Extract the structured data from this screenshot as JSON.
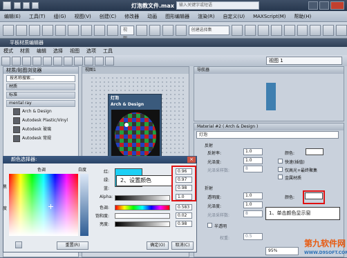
{
  "app": {
    "title": "灯泡教文件.max",
    "search_placeholder": "输入关键字或短语"
  },
  "menubar": [
    "编辑(E)",
    "工具(T)",
    "组(G)",
    "视图(V)",
    "创建(C)",
    "修改器",
    "动画",
    "图形编辑器",
    "渲染(R)",
    "自定义(U)",
    "MAXScript(M)",
    "帮助(H)"
  ],
  "toolbar": {
    "selection_set_placeholder": "创建选择集",
    "view_label": "视图"
  },
  "sme": {
    "title": "平板材质编辑器",
    "menu": [
      "模式",
      "材质",
      "编辑",
      "选择",
      "视图",
      "选项",
      "工具"
    ],
    "view_select": "视图 1"
  },
  "browser": {
    "header": "材质/贴图浏览器",
    "search_placeholder": "按名称搜索...",
    "categories": [
      "材质",
      "标准",
      "mental ray"
    ],
    "materials": [
      "Arch & Design",
      "Autodesk Plastic/Vinyl",
      "Autodesk 玻璃",
      "Autodesk 常规"
    ]
  },
  "view1": {
    "tab": "视图1",
    "node_title": "灯泡",
    "node_subtitle": "Arch & Design"
  },
  "navigator": {
    "header": "导航器"
  },
  "params": {
    "header": "Material #2 ( Arch & Design )",
    "material_name": "灯泡",
    "reflection": {
      "group": "反射",
      "reflectivity_label": "反射率:",
      "reflectivity": "1.0",
      "color_label": "颜色:",
      "gloss_label": "光泽度:",
      "gloss": "1.0",
      "gloss_samples_label": "光泽采样数:",
      "gloss_samples": "8",
      "fast_label": "快速(插值)",
      "highlights_label": "仅高光+最终聚集",
      "metal_label": "金属材质"
    },
    "refraction": {
      "group": "折射",
      "transparency_label": "透明度:",
      "transparency": "1.0",
      "color_label": "颜色:",
      "gloss_label": "光泽度:",
      "gloss": "1.0",
      "gloss_samples_label": "光泽采样数:",
      "gloss_samples": "8"
    },
    "translucency_label": "半透明",
    "weight_label": "权重:",
    "weight": "0.5",
    "zoom": "95%"
  },
  "color_dialog": {
    "title": "颜色选择器:",
    "hue_label": "色调",
    "whiteness_label": "白度",
    "black_label": "黑",
    "degree_label": "度",
    "channels": [
      {
        "label": "红:",
        "value": "0.96"
      },
      {
        "label": "绿:",
        "value": "0.97"
      },
      {
        "label": "蓝:",
        "value": "0.98"
      },
      {
        "label": "Alpha:",
        "value": "1.0"
      },
      {
        "label": "色调:",
        "value": "0.583"
      },
      {
        "label": "饱和度:",
        "value": "0.02"
      },
      {
        "label": "亮度:",
        "value": "0.98"
      }
    ],
    "reset_label": "重置(R)",
    "ok_label": "确定(O)",
    "cancel_label": "取消(C)"
  },
  "callouts": {
    "step2": "2、设置颜色",
    "step1": "1、单击颜色显示窗"
  },
  "watermark": {
    "brand": "第九软件网",
    "url": "WWW.D9SOFT.COM"
  },
  "colors": {
    "accent_red": "#e01010",
    "selection_cyan": "#1dd0f5"
  }
}
